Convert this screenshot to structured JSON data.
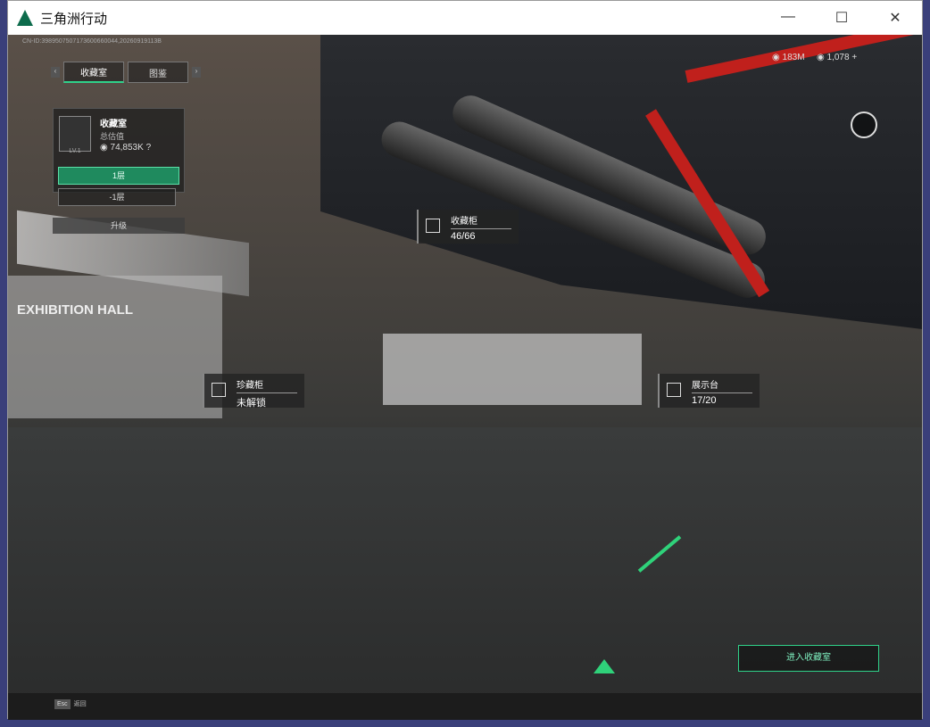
{
  "window": {
    "title": "三角洲行动",
    "min": "—",
    "max": "☐",
    "close": "✕"
  },
  "info": "CN-ID:3989507507173600660044,20260919113B",
  "tabs": [
    {
      "label": "收藏室",
      "active": true
    },
    {
      "label": "图鉴",
      "active": false
    }
  ],
  "panel": {
    "title": "收藏室",
    "sub": "总估值",
    "value": "74,853K",
    "level": "LV.1",
    "help": "?"
  },
  "floors": [
    "1层",
    "-1层"
  ],
  "upgrade": "升级",
  "currency": [
    {
      "value": "183M"
    },
    {
      "value": "1,078 +"
    }
  ],
  "labels": [
    {
      "title": "收藏柜",
      "value": "46/66"
    },
    {
      "title": "珍藏柜",
      "value": "未解锁"
    },
    {
      "title": "展示台",
      "value": "17/20"
    }
  ],
  "hall": "EXHIBITION HALL",
  "enter": "进入收藏室",
  "esc": {
    "key": "Esc",
    "label": "返回"
  }
}
